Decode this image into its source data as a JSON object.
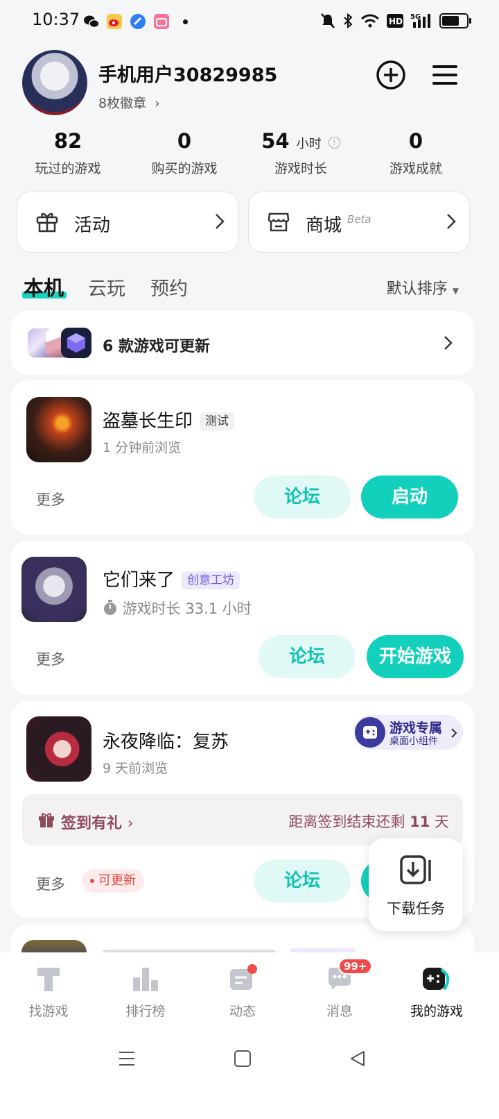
{
  "status_bar": {
    "time": "10:37",
    "battery_level": 0.8
  },
  "profile": {
    "username": "手机用户30829985",
    "badges": "8枚徽章",
    "stats": [
      {
        "value": "82",
        "unit": "",
        "label": "玩过的游戏"
      },
      {
        "value": "0",
        "unit": "",
        "label": "购买的游戏"
      },
      {
        "value": "54",
        "unit": "小时",
        "label": "游戏时长"
      },
      {
        "value": "0",
        "unit": "",
        "label": "游戏成就"
      }
    ]
  },
  "quick_links": {
    "activity": "活动",
    "shop": "商城",
    "shop_badge": "Beta"
  },
  "tabs": [
    {
      "label": "本机",
      "active": true
    },
    {
      "label": "云玩",
      "active": false
    },
    {
      "label": "预约",
      "active": false
    }
  ],
  "sort_label": "默认排序",
  "updates_banner": "6 款游戏可更新",
  "games": [
    {
      "name": "盗墓长生印",
      "tag": "测试",
      "subtitle": "1 分钟前浏览",
      "more": "更多",
      "forum": "论坛",
      "action": "启动"
    },
    {
      "name": "它们来了",
      "tag": "创意工坊",
      "subtitle": "游戏时长 33.1 小时",
      "more": "更多",
      "forum": "论坛",
      "action": "开始游戏"
    },
    {
      "name": "永夜降临：复苏",
      "widget_title": "游戏专属",
      "widget_sub": "桌面小组件",
      "subtitle": "9 天前浏览",
      "signin": "签到有礼",
      "signin_left": "距离签到结束还剩",
      "signin_days": "11",
      "signin_unit": "天",
      "more": "更多",
      "update_tag": "可更新",
      "forum": "论坛"
    }
  ],
  "download_tasks": "下载任务",
  "nav": {
    "items": [
      {
        "label": "找游戏"
      },
      {
        "label": "排行榜"
      },
      {
        "label": "动态"
      },
      {
        "label": "消息",
        "badge": "99+"
      },
      {
        "label": "我的游戏"
      }
    ]
  },
  "colors": {
    "accent": "#13d0bc",
    "accent_light": "#e1f9f6",
    "purple": "#6b5bd6"
  }
}
